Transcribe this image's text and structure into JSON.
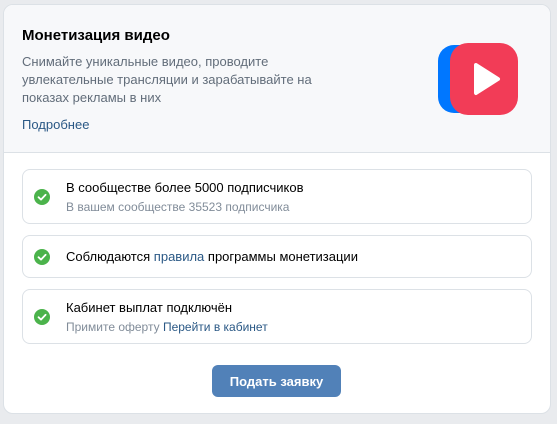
{
  "header": {
    "title": "Монетизация видео",
    "description": "Снимайте уникальные видео, проводите увлекательные трансляции и зарабатывайте на показах рекламы в них",
    "more_link": "Подробнее",
    "logo_icon": "vk-video-play-icon"
  },
  "requirements": [
    {
      "title": "В сообществе более 5000 подписчиков",
      "subtitle": "В вашем сообществе 35523 подписчика",
      "status_icon": "check-circle-icon"
    },
    {
      "title_before": "Соблюдаются",
      "title_link": "правила",
      "title_after": "программы монетизации",
      "status_icon": "check-circle-icon"
    },
    {
      "title": "Кабинет выплат подключён",
      "subtitle_text": "Примите оферту",
      "subtitle_link": "Перейти в кабинет",
      "status_icon": "check-circle-icon"
    }
  ],
  "actions": {
    "submit_label": "Подать заявку"
  },
  "colors": {
    "accent": "#5181b8",
    "link": "#2a5885",
    "check": "#4bb34b",
    "logo_red": "#f23c57",
    "logo_blue": "#0077ff"
  }
}
